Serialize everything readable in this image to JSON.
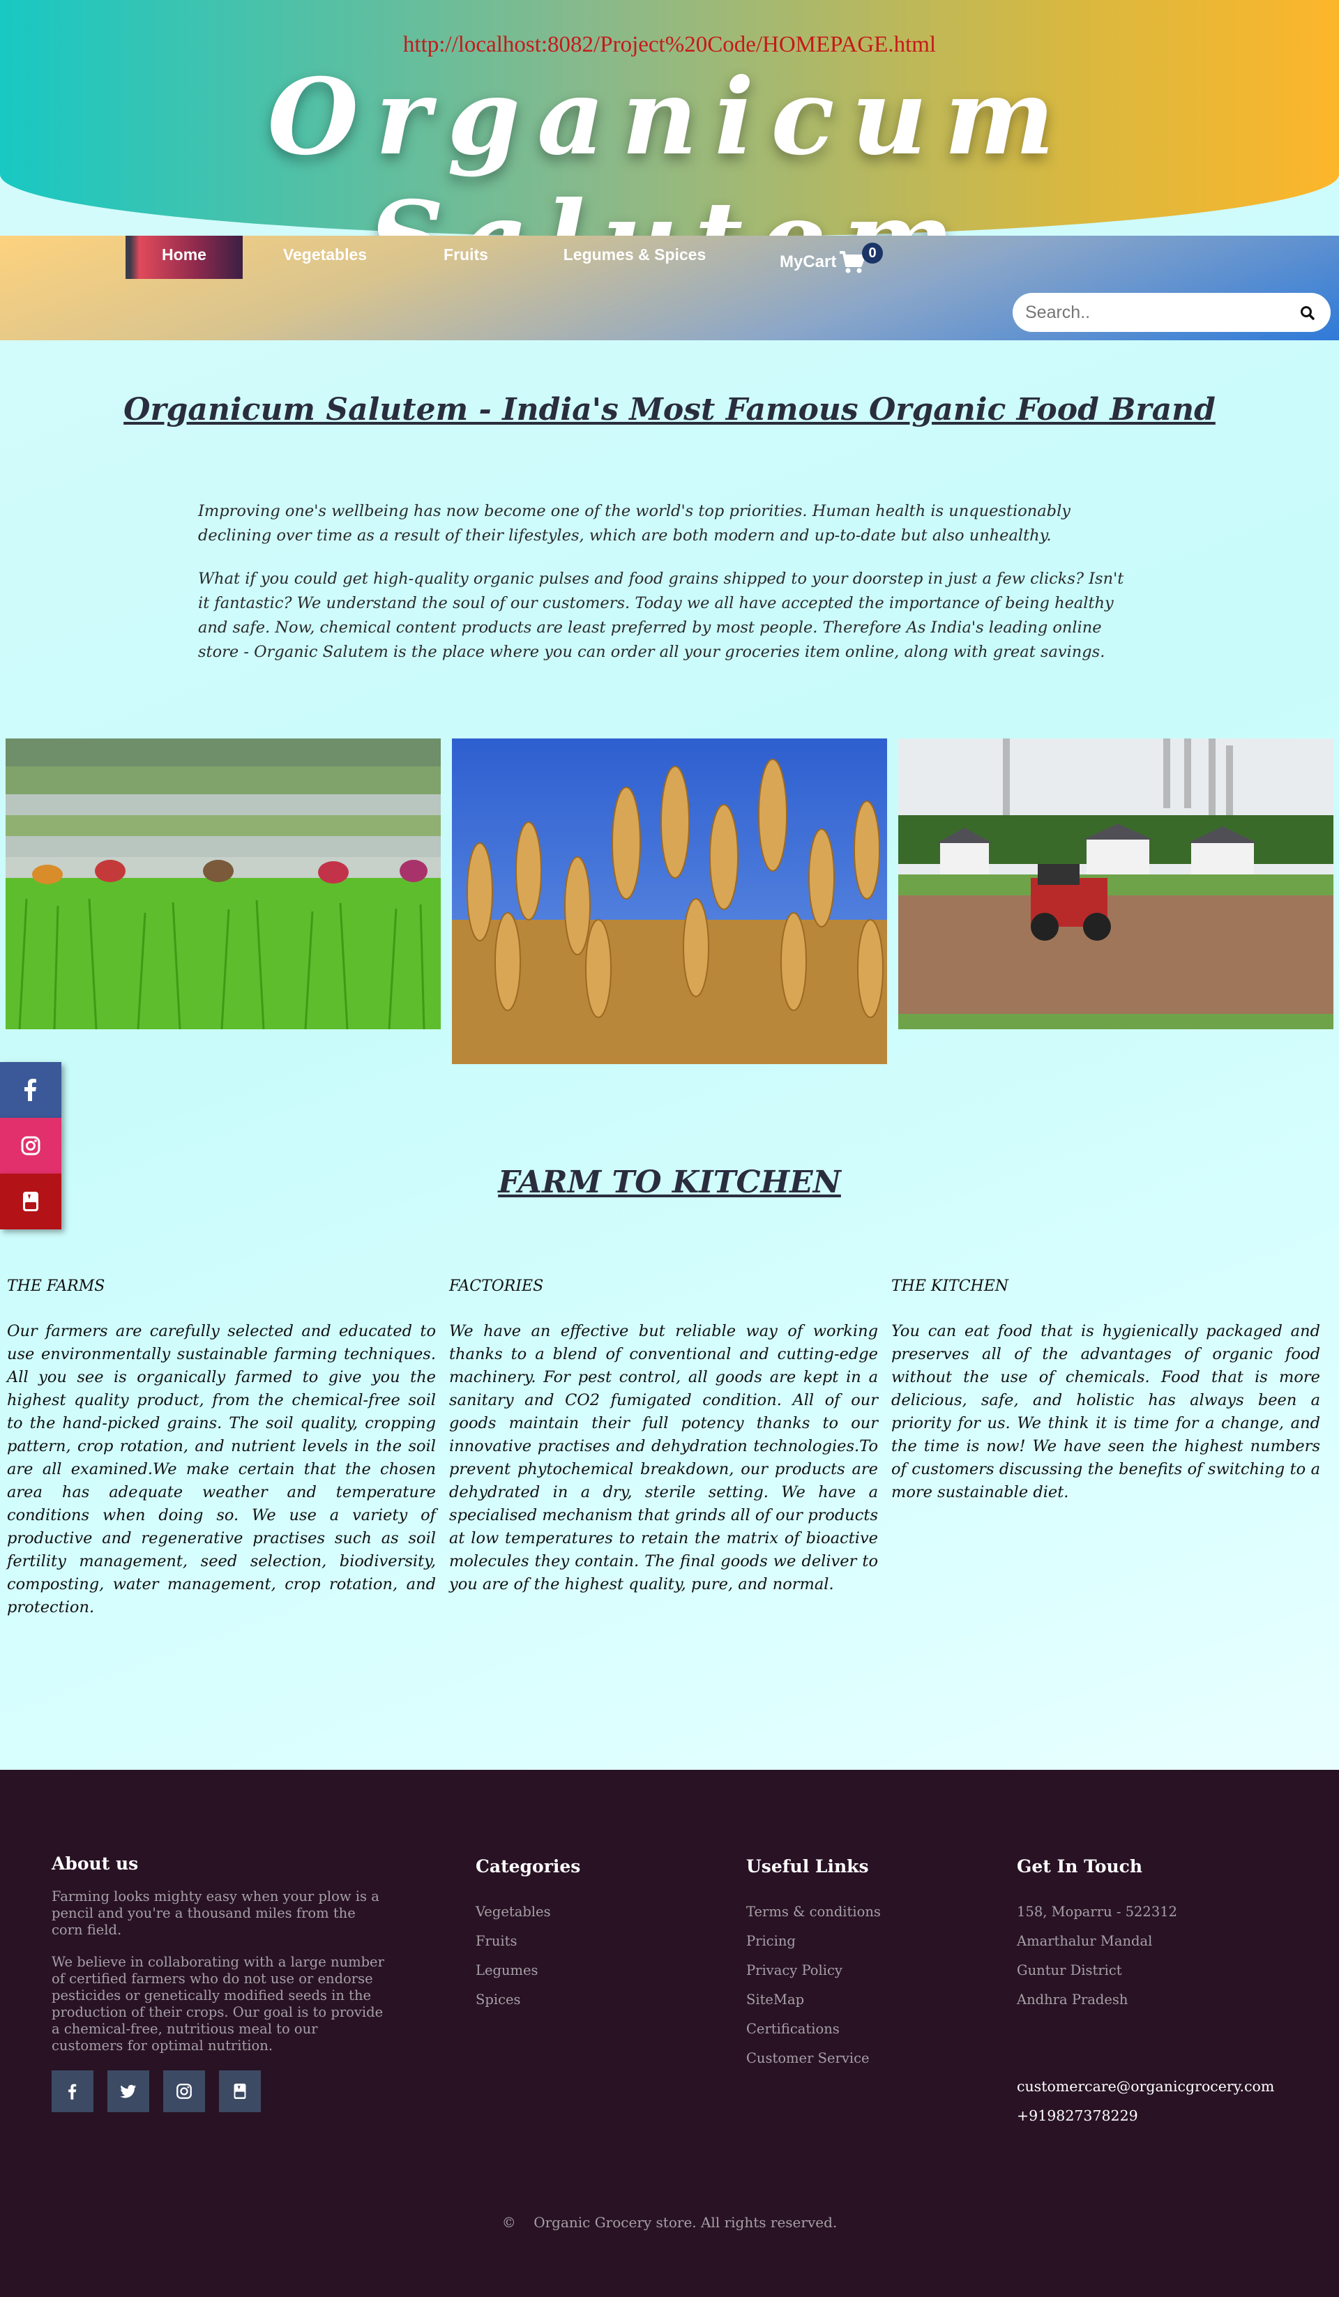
{
  "header": {
    "url": "http://localhost:8082/Project%20Code/HOMEPAGE.html",
    "brand": "Organicum Salutem"
  },
  "nav": {
    "items": [
      {
        "label": "Home",
        "active": true
      },
      {
        "label": "Vegetables"
      },
      {
        "label": "Fruits"
      },
      {
        "label": "Legumes & Spices"
      }
    ],
    "cart_label": "MyCart",
    "cart_count": "0",
    "search_placeholder": "Search.."
  },
  "intro": {
    "title": "Organicum Salutem - India's Most Famous Organic Food Brand",
    "p1": "Improving one's wellbeing has now become one of the world's top priorities. Human health is unquestionably declining over time as a result of their lifestyles, which are both modern and up-to-date but also unhealthy.",
    "p2": "What if you could get high-quality organic pulses and food grains shipped to your doorstep in just a few clicks? Isn't it fantastic? We understand the soul of our customers. Today we all have accepted the importance of being healthy and safe. Now, chemical content products are least preferred by most people. Therefore As India's leading online store - Organic Salutem is the place where you can order all your groceries item online, along with great savings."
  },
  "colors": {
    "footer_bg": "#281224",
    "facebook": "#3b5998",
    "instagram": "#e1306c",
    "youtube": "#b31217"
  },
  "farm_to_kitchen": {
    "title": "FARM TO KITCHEN",
    "columns": [
      {
        "heading": "THE FARMS",
        "text": "Our farmers are carefully selected and educated to use environmentally sustainable farming techniques. All you see is organically farmed to give you the highest quality product, from the chemical-free soil to the hand-picked grains. The soil quality, cropping pattern, crop rotation, and nutrient levels in the soil are all examined.We make certain that the chosen area has adequate weather and temperature conditions when doing so. We use a variety of productive and regenerative practises such as soil fertility management, seed selection, biodiversity, composting, water management, crop rotation, and protection."
      },
      {
        "heading": "FACTORIES",
        "text": "We have an effective but reliable way of working thanks to a blend of conventional and cutting-edge machinery. For pest control, all goods are kept in a sanitary and CO2 fumigated condition. All of our goods maintain their full potency thanks to our innovative practises and dehydration technologies.To prevent phytochemical breakdown, our products are dehydrated in a dry, sterile setting. We have a specialised mechanism that grinds all of our products at low temperatures to retain the matrix of bioactive molecules they contain. The final goods we deliver to you are of the highest quality, pure, and normal."
      },
      {
        "heading": "THE KITCHEN",
        "text": "You can eat food that is hygienically packaged and preserves all of the advantages of organic food without the use of chemicals. Food that is more delicious, safe, and holistic has always been a priority for us. We think it is time for a change, and the time is now! We have seen the highest numbers of customers discussing the benefits of switching to a more sustainable diet."
      }
    ]
  },
  "footer": {
    "about": {
      "heading": "About us",
      "p1": "Farming looks mighty easy when your plow is a pencil and you're a thousand miles from the corn field.",
      "p2": "We believe in collaborating with a large number of certified farmers who do not use or endorse pesticides or genetically modified seeds in the production of their crops. Our goal is to provide a chemical-free, nutritious meal to our customers for optimal nutrition."
    },
    "categories": {
      "heading": "Categories",
      "items": [
        "Vegetables",
        "Fruits",
        "Legumes",
        "Spices"
      ]
    },
    "useful_links": {
      "heading": "Useful Links",
      "items": [
        "Terms & conditions",
        "Pricing",
        "Privacy Policy",
        "SiteMap",
        "Certifications",
        "Customer Service"
      ]
    },
    "contact": {
      "heading": "Get In Touch",
      "address": [
        "158, Moparru - 522312",
        "Amarthalur Mandal",
        "Guntur District",
        "Andhra Pradesh"
      ],
      "email": "customercare@organicgrocery.com",
      "phone": "+919827378229"
    },
    "copyright_symbol": "©",
    "copyright": "Organic Grocery store. All rights reserved."
  }
}
